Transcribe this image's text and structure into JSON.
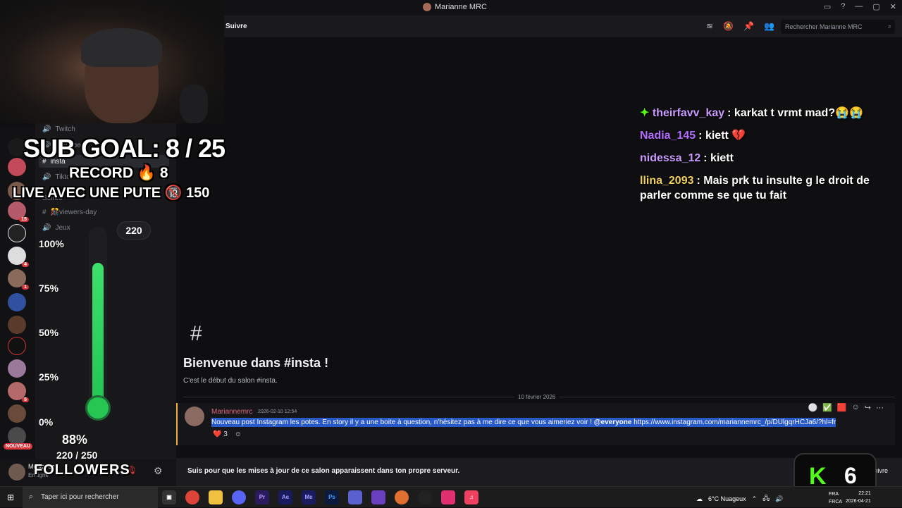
{
  "window": {
    "title": "Marianne MRC"
  },
  "header": {
    "follow_label": "Suivre",
    "search_placeholder": "Rechercher Marianne MRC"
  },
  "channels": [
    {
      "name": "Twitch",
      "type": "voice"
    },
    {
      "name": "Youtube",
      "type": "voice"
    },
    {
      "name": "insta",
      "type": "text"
    },
    {
      "name": "Tiktok",
      "type": "voice"
    },
    {
      "name": "Soirée",
      "type": "category"
    },
    {
      "name": "🎊viewers-day",
      "type": "text"
    },
    {
      "name": "Jeux",
      "type": "voice"
    }
  ],
  "overlay": {
    "sub_goal": "SUB GOAL: 8 / 25",
    "record": "RECORD 🔥 8",
    "live": "LIVE AVEC UNE PUTE 🔞 150",
    "gauge_value": "220",
    "gauge_level": 0.88,
    "ticks": [
      "100%",
      "75%",
      "50%",
      "25%",
      "0%"
    ],
    "percent": "88%",
    "fraction": "220 / 250",
    "followers_label": "FOLLOWERS",
    "kick_count": "6",
    "kick_logo": "K"
  },
  "chat": [
    {
      "prefix": "✦",
      "user": "theirfavv_kay",
      "color": "#c89bff",
      "text": ": karkat t vrmt mad?😭😭"
    },
    {
      "prefix": "",
      "user": "Nadia_145",
      "color": "#b46dff",
      "text": ": kiett 💔"
    },
    {
      "prefix": "",
      "user": "nidessa_12",
      "color": "#c89bff",
      "text": ": kiett"
    },
    {
      "prefix": "",
      "user": "llina_2093",
      "color": "#f0d060",
      "text": ": Mais prk tu insulte g le droit de parler comme se que tu fait"
    }
  ],
  "main": {
    "hash": "#",
    "welcome": "Bienvenue dans #insta !",
    "welcome_sub": "C'est le début du salon #insta.",
    "date": "10 février 2026"
  },
  "message": {
    "author": "Mariannemrc",
    "time": "2026-02-10 12:54",
    "text": "Nouveau post Instagram les potes. En story il y a une boite à question, n'hésitez pas à me dire ce que vous aimeriez voir ! ",
    "mention": "@everyone",
    "link": " https://www.instagram.com/mariannemrc_/p/DUlgqrHCJa6/?hl=fr",
    "reaction_count": "3"
  },
  "userbar": {
    "name": "Melkobar",
    "status": "En ligne"
  },
  "server_badges": {
    "nouveau": "NOUVEAU",
    "b1": "15",
    "b2": "4",
    "b3": "1",
    "b4": "5"
  },
  "followbar": {
    "text": "Suis pour que les mises à jour de ce salon apparaissent dans ton propre serveur.",
    "button": "Suivre"
  },
  "taskbar": {
    "search_placeholder": "Taper ici pour rechercher",
    "weather": "6°C  Nuageux",
    "lang1": "FRA",
    "lang2": "FRCA",
    "time": "22:21",
    "date": "2026-04-21",
    "apps": [
      "Ae",
      "Me",
      "Ps",
      "Pr"
    ]
  },
  "colors": {
    "accent": "#53fc18",
    "mention_highlight": "#2859c7",
    "author": "#e06a7a",
    "gauge": "#27c552"
  }
}
